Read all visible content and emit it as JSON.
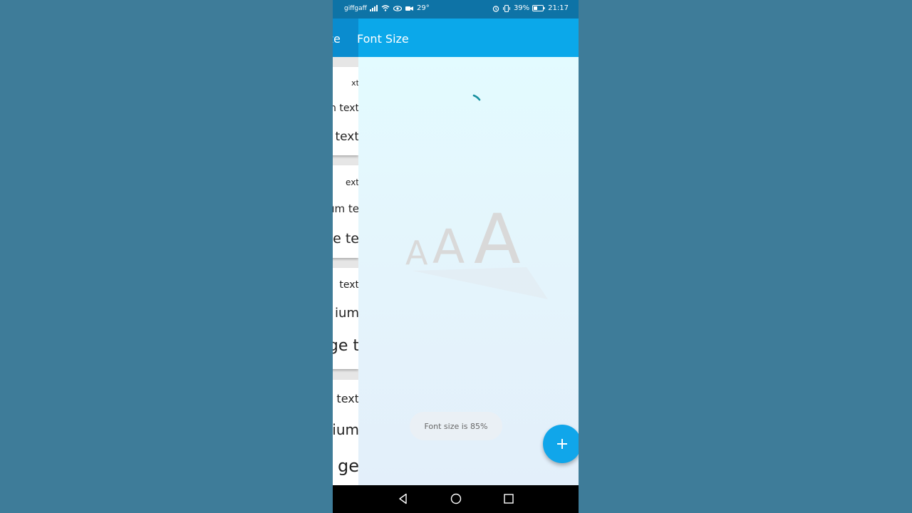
{
  "status_bar": {
    "carrier": "giffgaff",
    "temperature": "29°",
    "battery": "39%",
    "time": "21:17"
  },
  "prev_page": {
    "title": "Size",
    "cards": [
      {
        "small": "xt",
        "medium": "m text",
        "large": "e text"
      },
      {
        "small": "ext",
        "medium": "um te",
        "large": "e te"
      },
      {
        "small": "text",
        "medium": "ium",
        "large": "ge t"
      },
      {
        "small": "text",
        "medium": "ium",
        "large": "ge"
      }
    ]
  },
  "app_bar": {
    "title": "Font Size"
  },
  "logo": {
    "letters": [
      "A",
      "A",
      "A"
    ]
  },
  "toast": {
    "text": "Font size is 85%"
  },
  "fab": {
    "icon": "plus-icon",
    "label": "+"
  },
  "nav": {
    "back": "back-icon",
    "home": "home-icon",
    "recents": "recents-icon"
  }
}
